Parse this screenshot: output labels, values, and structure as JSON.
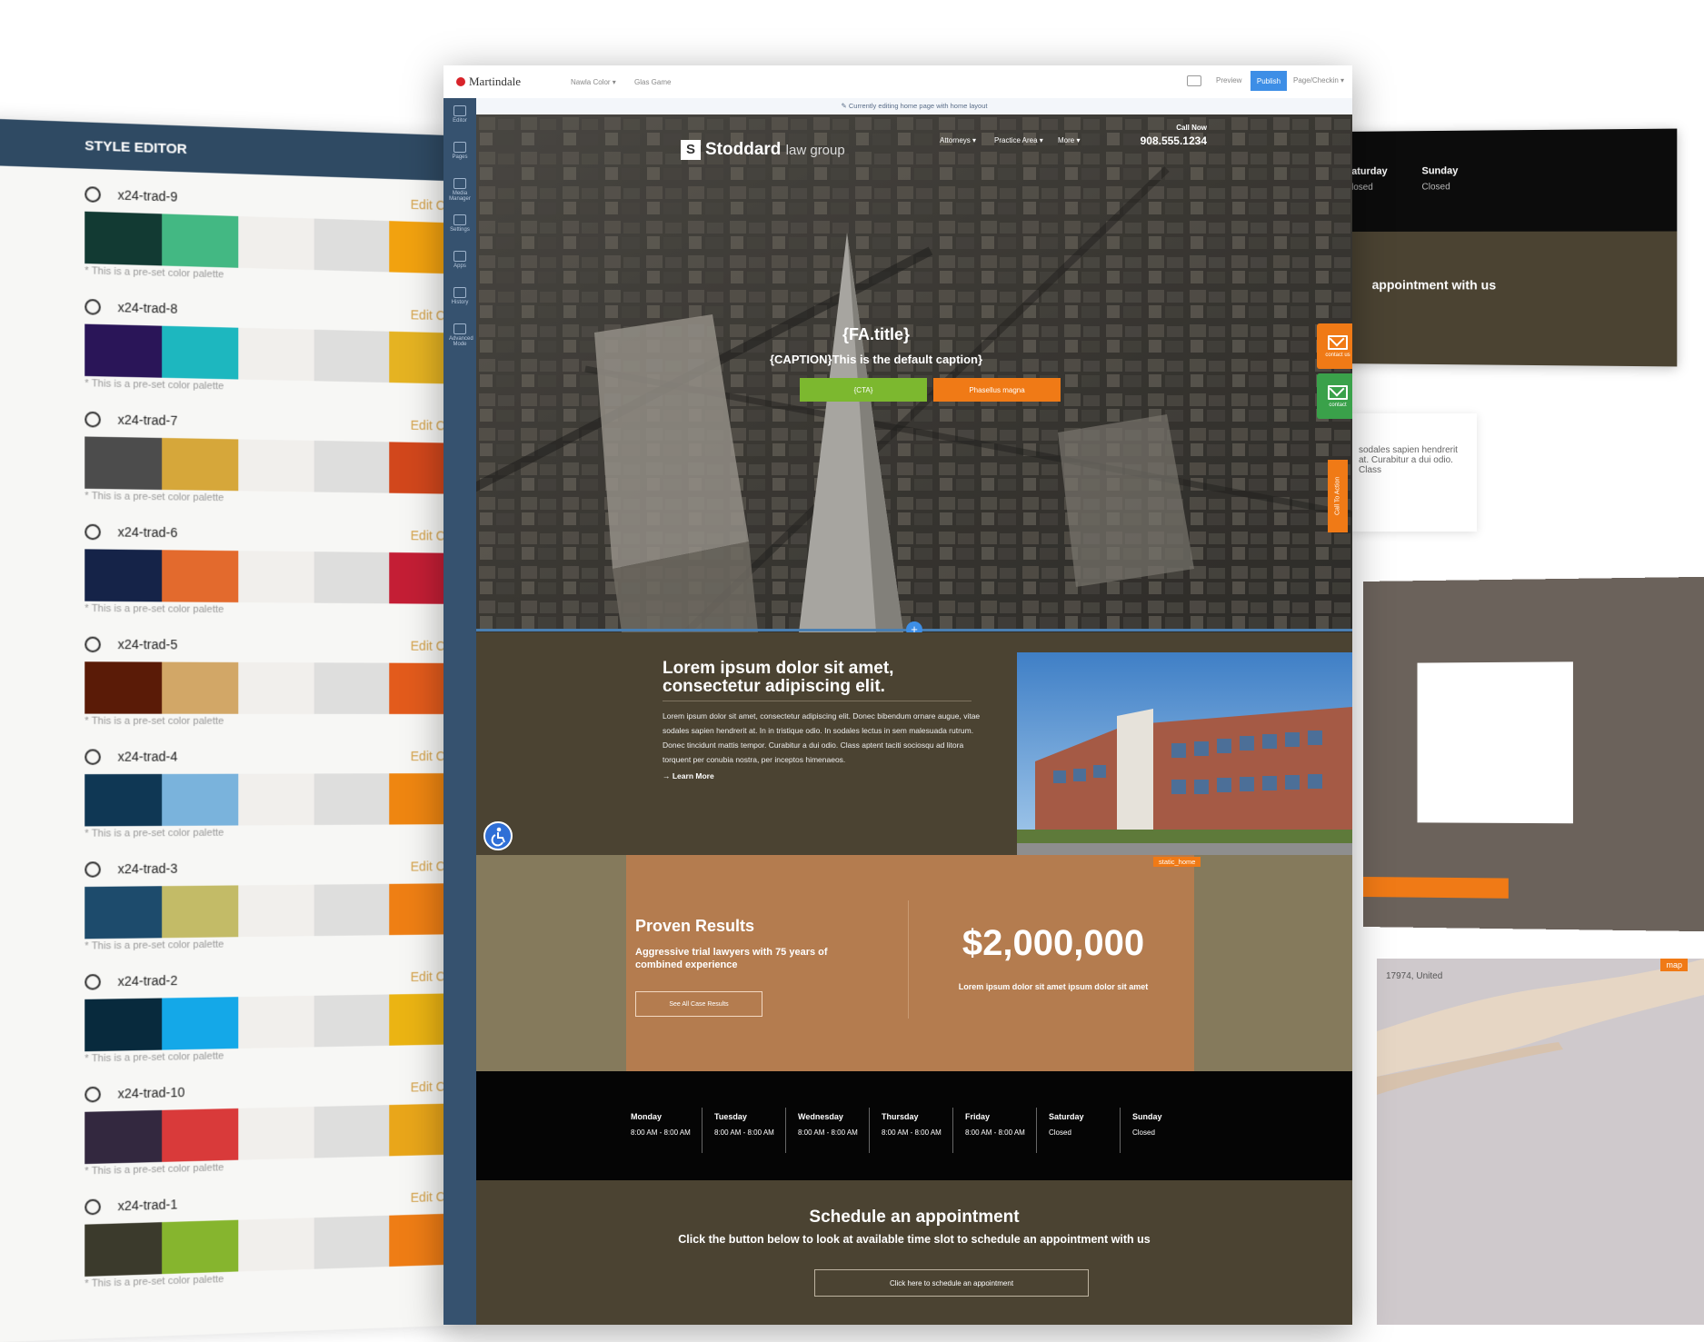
{
  "style_editor": {
    "title": "STYLE EDITOR",
    "edit_label": "Edit Colors",
    "note": "* This is a pre-set color palette",
    "palettes": [
      {
        "name": "x24-trad-9",
        "colors": [
          "#123a33",
          "#43b883",
          "#f1efec",
          "#dededd",
          "#f2a20f"
        ]
      },
      {
        "name": "x24-trad-8",
        "colors": [
          "#2a1558",
          "#1db7bf",
          "#f1efec",
          "#dededd",
          "#e5b322"
        ]
      },
      {
        "name": "x24-trad-7",
        "colors": [
          "#4c4c4c",
          "#d6a73a",
          "#f1efec",
          "#dededd",
          "#d2471c"
        ]
      },
      {
        "name": "x24-trad-6",
        "colors": [
          "#152348",
          "#e36a2d",
          "#f1efec",
          "#dededd",
          "#c41e35"
        ]
      },
      {
        "name": "x24-trad-5",
        "colors": [
          "#5a1b07",
          "#d2a767",
          "#f1efec",
          "#dededd",
          "#e35b1c"
        ]
      },
      {
        "name": "x24-trad-4",
        "colors": [
          "#0f3754",
          "#7ab3dc",
          "#f1efec",
          "#dededd",
          "#ef8611"
        ]
      },
      {
        "name": "x24-trad-3",
        "colors": [
          "#1d4b6c",
          "#c3bb67",
          "#f1efec",
          "#dededd",
          "#ef7f14"
        ]
      },
      {
        "name": "x24-trad-2",
        "colors": [
          "#082a3d",
          "#14a8e8",
          "#f1efec",
          "#dededd",
          "#ebb413"
        ]
      },
      {
        "name": "x24-trad-10",
        "colors": [
          "#33283f",
          "#d93a3a",
          "#f1efec",
          "#dededd",
          "#e9a61a"
        ]
      },
      {
        "name": "x24-trad-1",
        "colors": [
          "#3b3a2c",
          "#86b52e",
          "#f1efec",
          "#dededd",
          "#ef7d15"
        ]
      }
    ]
  },
  "cms": {
    "brand": "Martindale",
    "menus": [
      "Nawla Color ▾",
      "Glas Game"
    ],
    "preview": "Preview",
    "publish": "Publish",
    "user": "Page/Checkin ▾",
    "edit_notice": "✎ Currently editing home page with home layout",
    "sidebar": [
      "Editor",
      "Pages",
      "Media Manager",
      "Settings",
      "Apps",
      "History",
      "Advanced Mode"
    ]
  },
  "hero": {
    "brand_initial": "S",
    "brand_name": "Stoddard",
    "brand_suffix": "law group",
    "nav": [
      "Attorneys ▾",
      "Practice Area ▾",
      "More ▾"
    ],
    "call_now": "Call Now",
    "phone": "908.555.1234",
    "title": "{FA.title}",
    "caption": "{CAPTION}This is the default caption}",
    "cta": "{CTA}",
    "cta2": "Phasellus magna",
    "contact_tab": "contact us",
    "contact_tab2": "contact",
    "call_to_action": "Call To Action",
    "plus": "+"
  },
  "about": {
    "title": "Lorem ipsum dolor sit amet, consectetur adipiscing elit.",
    "body": "Lorem ipsum dolor sit amet, consectetur adipiscing elit. Donec bibendum ornare augue, vitae sodales sapien hendrerit at. In in tristique odio. In sodales lectus in sem malesuada rutrum. Donec tincidunt mattis tempor. Curabitur a dui odio. Class aptent taciti sociosqu ad litora torquent per conubia nostra, per inceptos himenaeos.",
    "link": "→ Learn More"
  },
  "results": {
    "tag": "static_home",
    "title": "Proven Results",
    "subtitle": "Aggressive trial lawyers with 75 years of combined experience",
    "button": "See All Case Results",
    "amount": "$2,000,000",
    "caption": "Lorem ipsum dolor sit amet ipsum dolor sit amet"
  },
  "hours": [
    {
      "day": "Monday",
      "hours": "8:00 AM - 8:00 AM"
    },
    {
      "day": "Tuesday",
      "hours": "8:00 AM - 8:00 AM"
    },
    {
      "day": "Wednesday",
      "hours": "8:00 AM - 8:00 AM"
    },
    {
      "day": "Thursday",
      "hours": "8:00 AM - 8:00 AM"
    },
    {
      "day": "Friday",
      "hours": "8:00 AM - 8:00 AM"
    },
    {
      "day": "Saturday",
      "hours": "Closed"
    },
    {
      "day": "Sunday",
      "hours": "Closed"
    }
  ],
  "schedule": {
    "title": "Schedule an appointment",
    "subtitle": "Click the button below to look at available time slot to schedule an appointment with us",
    "button": "Click here to schedule an appointment"
  },
  "backdrop": {
    "saturday": "Saturday",
    "sunday": "Sunday",
    "closed": "Closed",
    "appointment_fragment": "appointment with us",
    "card_text": "sodales sapien hendrerit at. Curabitur a dui odio. Class",
    "map_label": "17974, United",
    "map_tag": "map"
  }
}
